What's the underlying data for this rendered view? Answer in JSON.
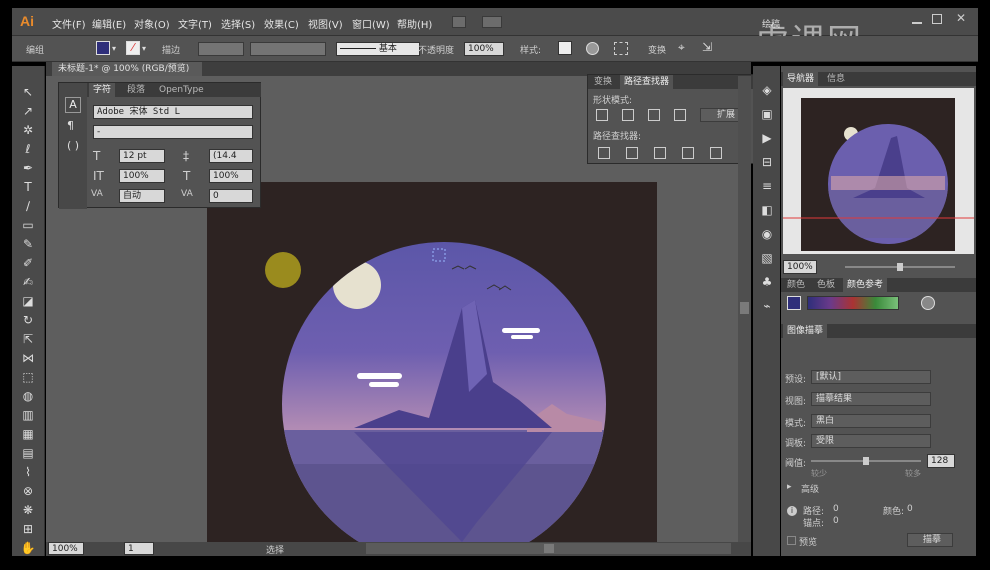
{
  "app": {
    "logo": "Ai"
  },
  "menu": [
    "文件(F)",
    "编辑(E)",
    "对象(O)",
    "文字(T)",
    "选择(S)",
    "效果(C)",
    "视图(V)",
    "窗口(W)",
    "帮助(H)"
  ],
  "workspace_switcher": "绘稿",
  "watermark": "虎课网",
  "control_bar": {
    "mode_label": "编组",
    "stroke_label": "描边",
    "stroke_profile": "基本",
    "opacity_label": "不透明度",
    "opacity_value": "100%",
    "style_label": "样式:",
    "transform_label": "变换"
  },
  "document_tab": {
    "title": "未标题-1* @ 100% (RGB/预览)",
    "close": "×"
  },
  "character_panel": {
    "tabs": [
      "字符",
      "段落",
      "OpenType"
    ],
    "font_family": "Adobe 宋体 Std L",
    "font_style": "-",
    "font_size": "12 pt",
    "leading": "(14.4",
    "vertical_scale": "100%",
    "horizontal_scale": "100%",
    "kerning": "自动",
    "tracking": "0"
  },
  "pathfinder_panel": {
    "tabs": [
      "变换",
      "路径查找器"
    ],
    "shape_modes_label": "形状模式:",
    "expand_button": "扩展",
    "pathfinders_label": "路径查找器:"
  },
  "navigator_panel": {
    "tabs": [
      "导航器",
      "信息"
    ],
    "zoom": "100%"
  },
  "color_guide_panel": {
    "tabs": [
      "颜色",
      "色板",
      "颜色参考"
    ]
  },
  "image_trace_panel": {
    "title": "图像描摹",
    "preset_label": "预设:",
    "preset_value": "[默认]",
    "view_label": "视图:",
    "view_value": "描摹结果",
    "mode_label": "模式:",
    "mode_value": "黑白",
    "palette_label": "调板:",
    "palette_value": "受限",
    "threshold_label": "阈值:",
    "threshold_value": "128",
    "threshold_less": "较少",
    "threshold_more": "较多",
    "advanced_label": "高级",
    "paths_label": "路径:",
    "paths_value": "0",
    "colors_label": "颜色:",
    "colors_value": "0",
    "anchors_label": "锚点:",
    "anchors_value": "0",
    "preview_label": "预览",
    "trace_button": "描摹"
  },
  "status_bar": {
    "zoom": "100%",
    "artboard_number": "1",
    "tool_name": "选择"
  },
  "colors": {
    "accent": "#e9902f",
    "artboard_bg": "#2d2322",
    "sky_top": "#5b56a8",
    "sun": "#9a8b1e",
    "moon": "#e6e1cf",
    "water": "#6a5f9e"
  }
}
